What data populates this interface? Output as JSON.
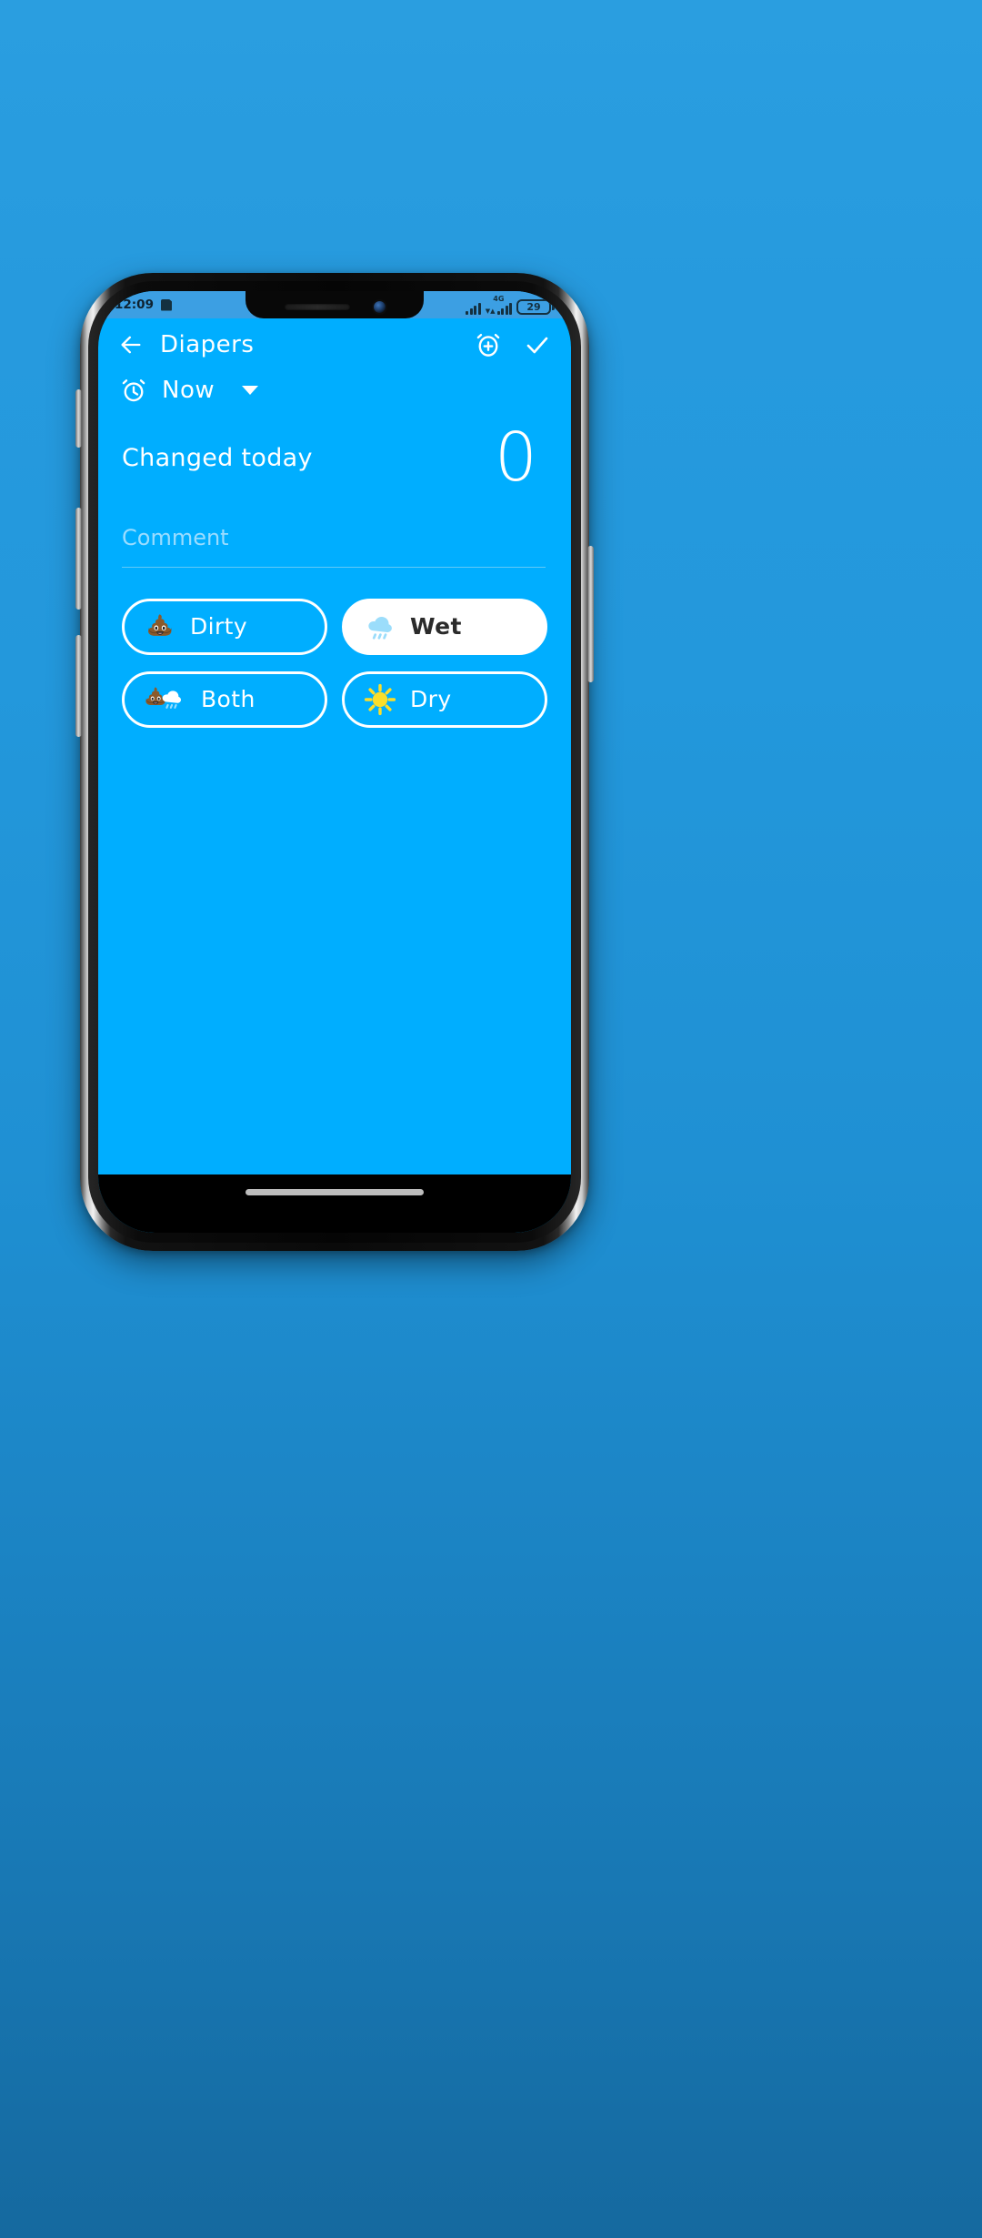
{
  "colors": {
    "app_background": "#00aeff",
    "wallpaper_top": "#2a9ee0",
    "wallpaper_bottom": "#15699f",
    "status_bar_background": "#3c9fe3",
    "status_bar_foreground": "#14303f",
    "accent_white": "#ffffff",
    "placeholder": "#9adcff",
    "selected_text": "#2b2b2b"
  },
  "status_bar": {
    "time": "12:09",
    "sd_card_icon": "sd-card-icon",
    "signal_icon": "signal-bars-icon",
    "network_type": "4G",
    "data_arrows": "data-transfer-icon",
    "battery_level": "29",
    "battery_icon": "battery-icon"
  },
  "header": {
    "back_icon": "back-arrow-icon",
    "title": "Diapers",
    "alarm_add_icon": "alarm-plus-icon",
    "confirm_icon": "check-icon"
  },
  "time_row": {
    "alarm_icon": "alarm-clock-icon",
    "value": "Now",
    "caret_icon": "chevron-down-icon"
  },
  "summary": {
    "label": "Changed today",
    "count": "0"
  },
  "comment": {
    "placeholder": "Comment",
    "value": ""
  },
  "choices": [
    {
      "id": "dirty",
      "label": "Dirty",
      "icon": "poop-emoji",
      "selected": false
    },
    {
      "id": "wet",
      "label": "Wet",
      "icon": "rain-cloud-emoji",
      "selected": true
    },
    {
      "id": "both",
      "label": "Both",
      "icon": "poop-and-rain-emoji",
      "selected": false
    },
    {
      "id": "dry",
      "label": "Dry",
      "icon": "sun-emoji",
      "selected": false
    }
  ],
  "system_nav": {
    "home_indicator": "home-indicator"
  }
}
